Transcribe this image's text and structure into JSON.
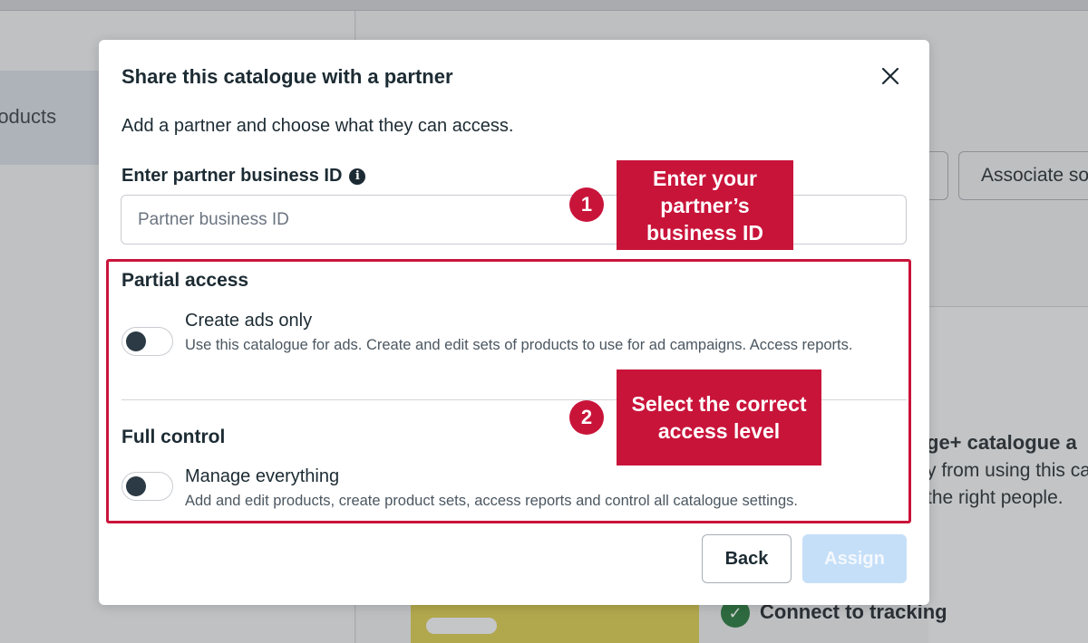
{
  "background": {
    "left_item_label": "roducts",
    "button_partial": "",
    "button_associate": "Associate so",
    "card_heading": "ge+ catalogue a",
    "card_line1": "y from using this ca",
    "card_line2": "the right people.",
    "connect_label": "Connect to tracking"
  },
  "modal": {
    "title": "Share this catalogue with a partner",
    "subtitle": "Add a partner and choose what they can access.",
    "field_label": "Enter partner business ID",
    "input_placeholder": "Partner business ID",
    "input_value": "",
    "partial": {
      "title": "Partial access",
      "option_title": "Create ads only",
      "option_desc": "Use this catalogue for ads. Create and edit sets of products to use for ad campaigns. Access reports.",
      "toggle_on": false
    },
    "full": {
      "title": "Full control",
      "option_title": "Manage everything",
      "option_desc": "Add and edit products, create product sets, access reports and control all catalogue settings.",
      "toggle_on": false
    },
    "back_label": "Back",
    "assign_label": "Assign"
  },
  "annotations": {
    "badge1": "1",
    "callout1": "Enter your partner’s business ID",
    "badge2": "2",
    "callout2": "Select the correct access level"
  },
  "colors": {
    "annotation_red": "#c9143a",
    "assign_disabled": "#c5dff8"
  }
}
